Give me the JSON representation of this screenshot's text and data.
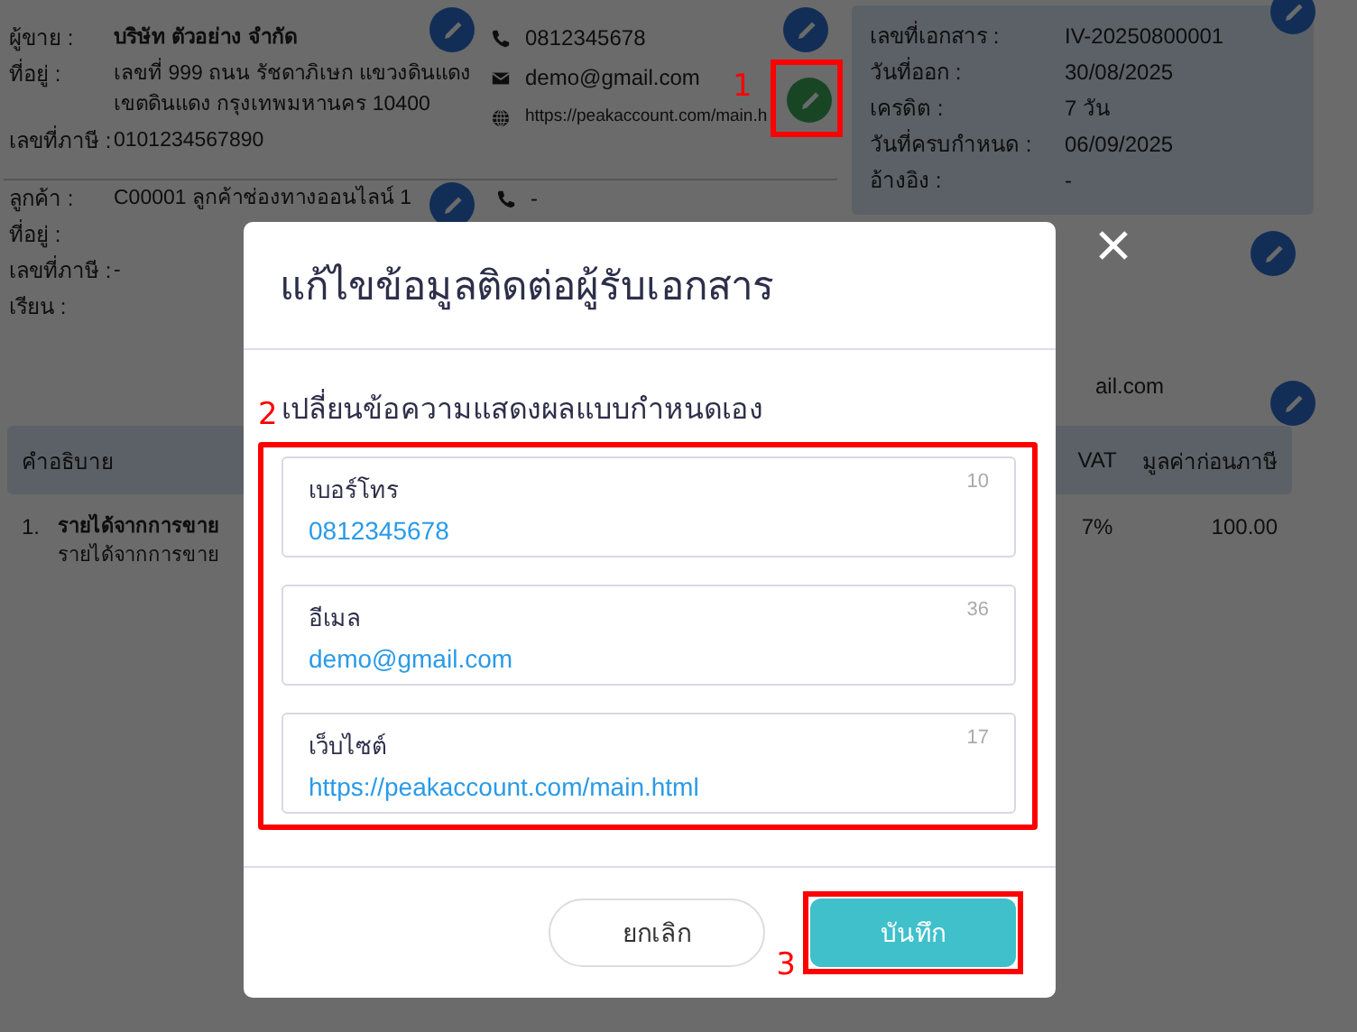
{
  "seller": {
    "rows": [
      {
        "label": "ผู้ขาย :",
        "lines": [
          "บริษัท ตัวอย่าง จำกัด"
        ],
        "bold": true
      },
      {
        "label": "ที่อยู่ :",
        "lines": [
          "เลขที่ 999 ถนน รัชดาภิเษก แขวงดินแดง",
          "เขตดินแดง กรุงเทพมหานคร 10400"
        ],
        "bold": false
      },
      {
        "label": "เลขที่ภาษี :",
        "lines": [
          "0101234567890"
        ],
        "bold": false
      }
    ],
    "contacts": [
      {
        "kind": "phone",
        "text": "0812345678"
      },
      {
        "kind": "email",
        "text": "demo@gmail.com"
      },
      {
        "kind": "website",
        "text": "https://peakaccount.com/main.h"
      }
    ]
  },
  "document": {
    "rows": [
      {
        "label": "เลขที่เอกสาร :",
        "value": "IV-20250800001"
      },
      {
        "label": "วันที่ออก :",
        "value": "30/08/2025"
      },
      {
        "label": "เครดิต :",
        "value": "7 วัน"
      },
      {
        "label": "วันที่ครบกำหนด :",
        "value": "06/09/2025"
      },
      {
        "label": "อ้างอิง :",
        "value": "-"
      }
    ]
  },
  "customer": {
    "rows": [
      {
        "label": "ลูกค้า :",
        "value": "C00001 ลูกค้าช่องทางออนไลน์ 1"
      },
      {
        "label": "ที่อยู่ :"
      },
      {
        "label": "เลขที่ภาษี :",
        "value": "-"
      },
      {
        "label": "เรียน :"
      }
    ],
    "contacts": [
      {
        "kind": "phone",
        "text": "-"
      },
      {
        "kind": "email",
        "text": "ail.com"
      }
    ]
  },
  "table": {
    "columns": [
      "คำอธิบาย",
      "VAT",
      "มูลค่าก่อนภาษี"
    ],
    "rows": [
      {
        "number": "1.",
        "title": "รายได้จากการขาย",
        "detail": "รายได้จากการขาย",
        "vat": "7%",
        "amount": "100.00"
      }
    ]
  },
  "dialog": {
    "title": "แก้ไขข้อมูลติดต่อผู้รับเอกสาร",
    "subtitle": "เปลี่ยนข้อความแสดงผลแบบกำหนดเอง",
    "fields": [
      {
        "label": "เบอร์โทร",
        "count": "10",
        "value": "0812345678"
      },
      {
        "label": "อีเมล",
        "count": "36",
        "value": "demo@gmail.com"
      },
      {
        "label": "เว็บไซต์",
        "count": "17",
        "value": "https://peakaccount.com/main.html"
      }
    ],
    "buttons": [
      {
        "label": "ยกเลิก",
        "kind": "secondary"
      },
      {
        "label": "บันทึก",
        "kind": "primary"
      }
    ]
  },
  "annotations": [
    "1",
    "2",
    "3"
  ]
}
